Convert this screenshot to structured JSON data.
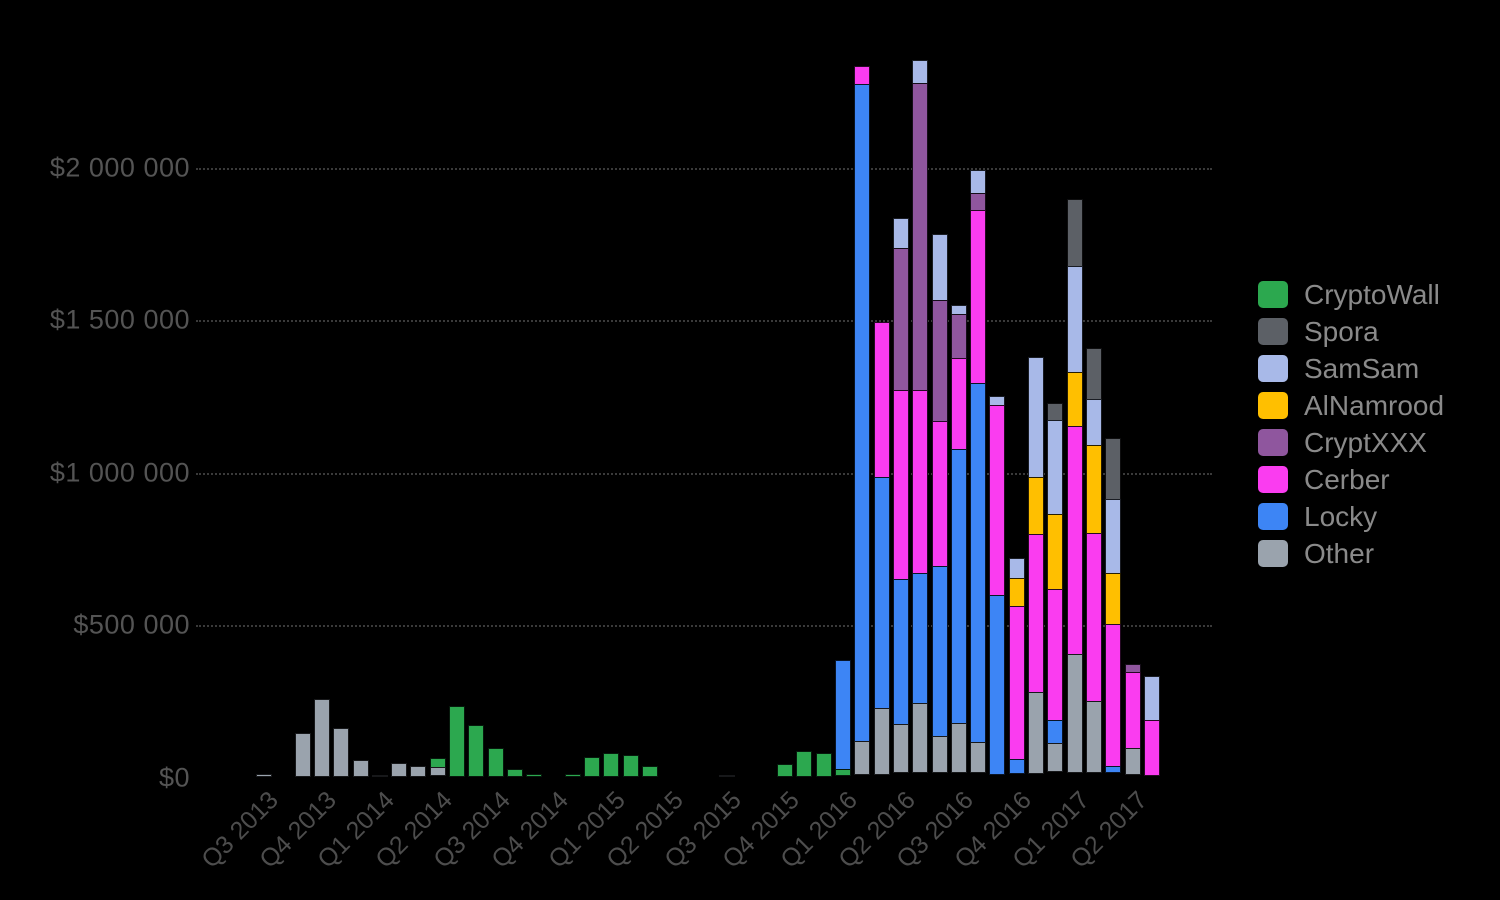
{
  "chart_data": {
    "type": "bar",
    "stacked": true,
    "title": "",
    "subtitle": "",
    "xlabel": "",
    "ylabel": "",
    "ylim": [
      0,
      2400000
    ],
    "grid": true,
    "legend_position": "right",
    "y_ticks": [
      {
        "value": 0,
        "label": "$0"
      },
      {
        "value": 500000,
        "label": "$500 000"
      },
      {
        "value": 1000000,
        "label": "$1 000 000"
      },
      {
        "value": 1500000,
        "label": "$1 500 000"
      },
      {
        "value": 2000000,
        "label": "$2 000 000"
      }
    ],
    "x_ticks": [
      {
        "index": 0,
        "label": "Q3 2013"
      },
      {
        "index": 3,
        "label": "Q4 2013"
      },
      {
        "index": 6,
        "label": "Q1 2014"
      },
      {
        "index": 9,
        "label": "Q2 2014"
      },
      {
        "index": 12,
        "label": "Q3 2014"
      },
      {
        "index": 15,
        "label": "Q4 2014"
      },
      {
        "index": 18,
        "label": "Q1 2015"
      },
      {
        "index": 21,
        "label": "Q2 2015"
      },
      {
        "index": 24,
        "label": "Q3 2015"
      },
      {
        "index": 27,
        "label": "Q4 2015"
      },
      {
        "index": 30,
        "label": "Q1 2016"
      },
      {
        "index": 33,
        "label": "Q2 2016"
      },
      {
        "index": 36,
        "label": "Q3 2016"
      },
      {
        "index": 39,
        "label": "Q4 2016"
      },
      {
        "index": 42,
        "label": "Q1 2017"
      },
      {
        "index": 45,
        "label": "Q2 2017"
      }
    ],
    "series": [
      {
        "name": "CryptoWall",
        "color": "#2ca84f"
      },
      {
        "name": "Spora",
        "color": "#5c6066"
      },
      {
        "name": "SamSam",
        "color": "#a8b9e8"
      },
      {
        "name": "AlNamrood",
        "color": "#ffbf00"
      },
      {
        "name": "CryptXXX",
        "color": "#8f569e"
      },
      {
        "name": "Cerber",
        "color": "#fa3cf0"
      },
      {
        "name": "Locky",
        "color": "#3d85f5"
      },
      {
        "name": "Other",
        "color": "#9aa3ad"
      }
    ],
    "bars": [
      {
        "i": 0,
        "v": {
          "Other": 10000
        }
      },
      {
        "i": 1,
        "v": {}
      },
      {
        "i": 2,
        "v": {
          "Other": 145000
        }
      },
      {
        "i": 3,
        "v": {
          "Other": 255000
        }
      },
      {
        "i": 4,
        "v": {
          "Other": 162000
        }
      },
      {
        "i": 5,
        "v": {
          "Other": 55000
        }
      },
      {
        "i": 6,
        "v": {
          "Other": 8000
        }
      },
      {
        "i": 7,
        "v": {
          "Other": 45000
        }
      },
      {
        "i": 8,
        "v": {
          "Other": 37000
        }
      },
      {
        "i": 9,
        "v": {
          "Other": 30000,
          "CryptoWall": 33000
        }
      },
      {
        "i": 10,
        "v": {
          "CryptoWall": 232000
        }
      },
      {
        "i": 11,
        "v": {
          "CryptoWall": 170000
        }
      },
      {
        "i": 12,
        "v": {
          "CryptoWall": 95000
        }
      },
      {
        "i": 13,
        "v": {
          "CryptoWall": 25000
        }
      },
      {
        "i": 14,
        "v": {
          "CryptoWall": 10000
        }
      },
      {
        "i": 15,
        "v": {}
      },
      {
        "i": 16,
        "v": {
          "CryptoWall": 10000
        }
      },
      {
        "i": 17,
        "v": {
          "CryptoWall": 65000
        }
      },
      {
        "i": 18,
        "v": {
          "CryptoWall": 80000
        }
      },
      {
        "i": 19,
        "v": {
          "CryptoWall": 72000
        }
      },
      {
        "i": 20,
        "v": {
          "CryptoWall": 35000
        }
      },
      {
        "i": 21,
        "v": {}
      },
      {
        "i": 22,
        "v": {}
      },
      {
        "i": 23,
        "v": {}
      },
      {
        "i": 24,
        "v": {
          "Other": 6000
        }
      },
      {
        "i": 25,
        "v": {}
      },
      {
        "i": 26,
        "v": {}
      },
      {
        "i": 27,
        "v": {
          "CryptoWall": 42000
        }
      },
      {
        "i": 28,
        "v": {
          "CryptoWall": 85000
        }
      },
      {
        "i": 29,
        "v": {
          "CryptoWall": 80000
        }
      },
      {
        "i": 30,
        "v": {
          "Locky": 362000,
          "CryptoWall": 22000
        }
      },
      {
        "i": 31,
        "v": {
          "Other": 112000,
          "Locky": 2155000,
          "Cerber": 62000
        }
      },
      {
        "i": 32,
        "v": {
          "Other": 220000,
          "Locky": 760000,
          "Cerber": 510000
        }
      },
      {
        "i": 33,
        "v": {
          "Other": 160000,
          "Locky": 480000,
          "Cerber": 620000,
          "CryptXXX": 470000,
          "SamSam": 100000
        }
      },
      {
        "i": 34,
        "v": {
          "Other": 230000,
          "Locky": 430000,
          "Cerber": 600000,
          "CryptXXX": 1010000,
          "SamSam": 80000
        }
      },
      {
        "i": 35,
        "v": {
          "Other": 120000,
          "Locky": 560000,
          "Cerber": 480000,
          "CryptXXX": 400000,
          "SamSam": 220000
        }
      },
      {
        "i": 36,
        "v": {
          "Other": 165000,
          "Locky": 900000,
          "Cerber": 300000,
          "CryptXXX": 150000,
          "SamSam": 30000
        }
      },
      {
        "i": 37,
        "v": {
          "Other": 100000,
          "Locky": 1180000,
          "Cerber": 570000,
          "CryptXXX": 60000,
          "SamSam": 80000
        }
      },
      {
        "i": 38,
        "v": {
          "Locky": 590000,
          "Cerber": 625000,
          "SamSam": 35000
        }
      },
      {
        "i": 39,
        "v": {
          "Locky": 48000,
          "Cerber": 505000,
          "AlNamrood": 95000,
          "SamSam": 70000
        }
      },
      {
        "i": 40,
        "v": {
          "Other": 270000,
          "Cerber": 520000,
          "AlNamrood": 190000,
          "SamSam": 395000
        }
      },
      {
        "i": 41,
        "v": {
          "Other": 95000,
          "Locky": 80000,
          "Cerber": 430000,
          "AlNamrood": 250000,
          "SamSam": 310000,
          "Spora": 60000
        }
      },
      {
        "i": 42,
        "v": {
          "Other": 390000,
          "Cerber": 750000,
          "AlNamrood": 180000,
          "SamSam": 350000,
          "Spora": 225000
        }
      },
      {
        "i": 43,
        "v": {
          "Other": 235000,
          "Cerber": 555000,
          "AlNamrood": 290000,
          "SamSam": 155000,
          "Spora": 170000
        }
      },
      {
        "i": 44,
        "v": {
          "Locky": 22000,
          "Cerber": 470000,
          "AlNamrood": 170000,
          "SamSam": 245000,
          "Spora": 205000
        }
      },
      {
        "i": 45,
        "v": {
          "Other": 90000,
          "Cerber": 250000,
          "CryptXXX": 30000
        }
      },
      {
        "i": 46,
        "v": {
          "Cerber": 185000,
          "SamSam": 145000
        }
      },
      {
        "i": 47,
        "v": {}
      },
      {
        "i": 48,
        "v": {}
      }
    ]
  }
}
